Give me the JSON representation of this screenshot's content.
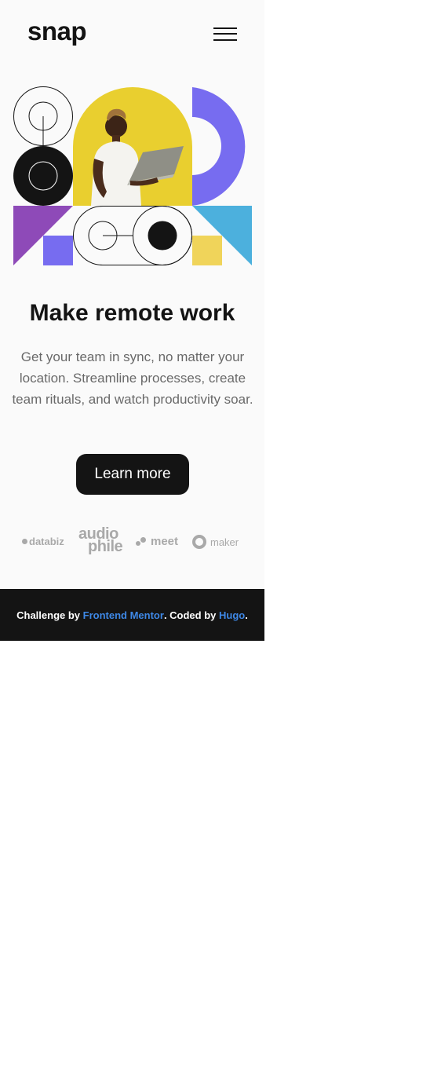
{
  "header": {
    "logo": "snap",
    "menu_icon": "hamburger-menu-icon"
  },
  "hero": {
    "illustration": "geometric-shapes-and-man-with-laptop",
    "colors": {
      "yellow": "#e9cf2f",
      "purple": "#776cf0",
      "violet": "#8e4ab8",
      "blue": "#4cb0dd",
      "sand": "#f0d45a",
      "dark": "#141414"
    }
  },
  "main": {
    "headline": "Make remote work",
    "subtext": "Get your team in sync, no matter your location. Streamline processes, create team rituals, and watch productivity soar.",
    "cta_label": "Learn more"
  },
  "clients": {
    "databiz": "databiz",
    "audiophile_top": "audio",
    "audiophile_bottom": "phile",
    "meet": "meet",
    "maker": "maker"
  },
  "footer": {
    "prefix": "Challenge by",
    "link1": "Frontend Mentor",
    "middle": ". Coded by",
    "link2": "Hugo",
    "suffix": "."
  },
  "theme": {
    "background": "#fafafa",
    "text_dark": "#141414",
    "text_gray": "#696969",
    "link_blue": "#3e88e6"
  }
}
